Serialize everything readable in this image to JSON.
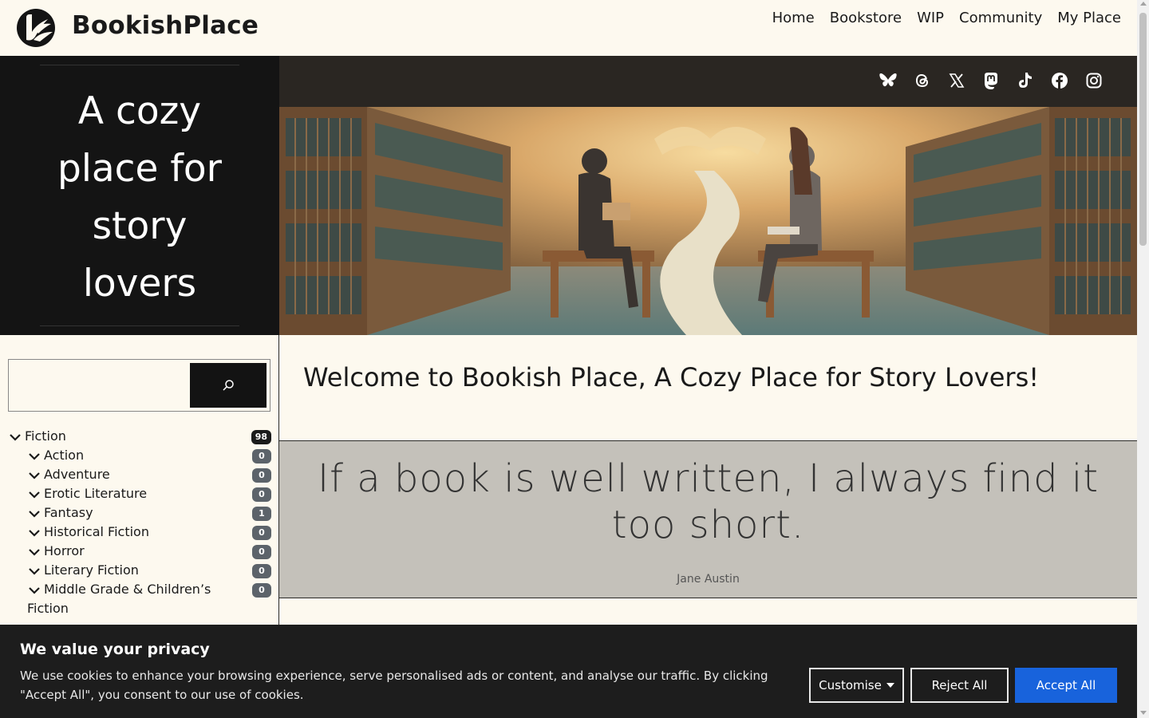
{
  "header": {
    "site_name": "BookishPlace",
    "nav": [
      "Home",
      "Bookstore",
      "WIP",
      "Community",
      "My Place"
    ]
  },
  "hero": {
    "tagline": "A cozy place for story lovers"
  },
  "social": [
    "bluesky-icon",
    "threads-icon",
    "x-icon",
    "mastodon-icon",
    "tiktok-icon",
    "facebook-icon",
    "instagram-icon"
  ],
  "search": {
    "placeholder": "",
    "value": ""
  },
  "categories": [
    {
      "label": "Fiction",
      "count": "98",
      "level": "root"
    },
    {
      "label": "Action",
      "count": "0",
      "level": "sub"
    },
    {
      "label": "Adventure",
      "count": "0",
      "level": "sub"
    },
    {
      "label": "Erotic Literature",
      "count": "0",
      "level": "sub"
    },
    {
      "label": "Fantasy",
      "count": "1",
      "level": "sub"
    },
    {
      "label": "Historical Fiction",
      "count": "0",
      "level": "sub"
    },
    {
      "label": "Horror",
      "count": "0",
      "level": "sub"
    },
    {
      "label": "Literary Fiction",
      "count": "0",
      "level": "sub"
    },
    {
      "label": "Middle Grade & Children’s Fiction",
      "count": "0",
      "level": "sub"
    }
  ],
  "main": {
    "welcome": "Welcome to Bookish Place, A Cozy Place for Story Lovers!",
    "quote": "If a book is well written, I always find it too short.",
    "quote_author": "Jane Austin"
  },
  "cookie": {
    "title": "We value your privacy",
    "text": "We use cookies to enhance your browsing experience, serve personalised ads or content, and analyse our traffic. By clicking \"Accept All\", you consent to our use of cookies.",
    "customise": "Customise",
    "reject": "Reject All",
    "accept": "Accept All"
  },
  "colors": {
    "background": "#fdf9ef",
    "hero_panel": "#141414",
    "quote_band": "#c4c1ba",
    "cookie_bg": "#1d1d1d",
    "accept_button": "#1863dc",
    "badge": "#5c636a"
  }
}
